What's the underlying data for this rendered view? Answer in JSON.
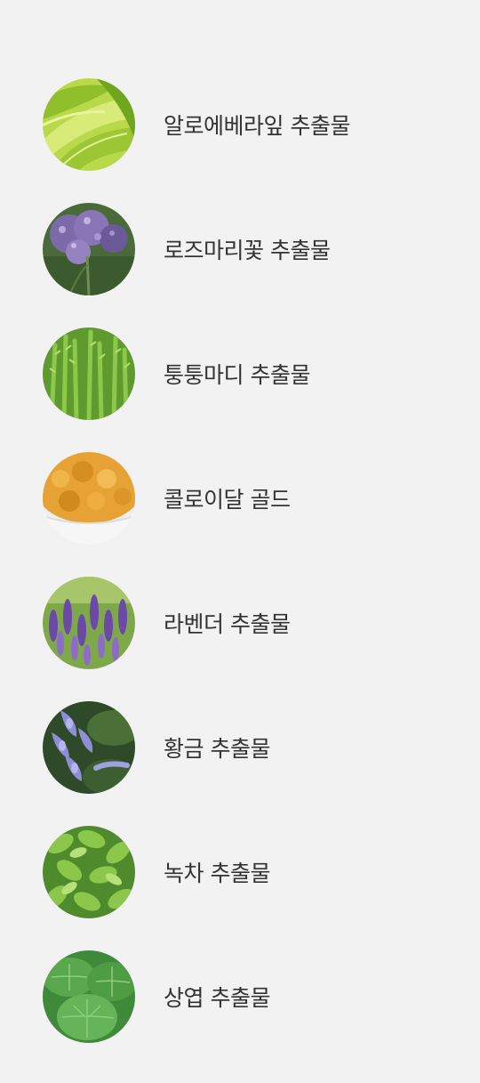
{
  "ingredients": [
    {
      "label": "알로에베라잎 추출물",
      "icon": "aloe-vera-leaf-image"
    },
    {
      "label": "로즈마리꽃 추출물",
      "icon": "rosemary-flower-image"
    },
    {
      "label": "퉁퉁마디 추출물",
      "icon": "glasswort-image"
    },
    {
      "label": "콜로이달 골드",
      "icon": "colloidal-gold-image"
    },
    {
      "label": "라벤더 추출물",
      "icon": "lavender-image"
    },
    {
      "label": "황금 추출물",
      "icon": "scutellaria-image"
    },
    {
      "label": "녹차 추출물",
      "icon": "green-tea-image"
    },
    {
      "label": "상엽 추출물",
      "icon": "mulberry-leaf-image"
    }
  ]
}
